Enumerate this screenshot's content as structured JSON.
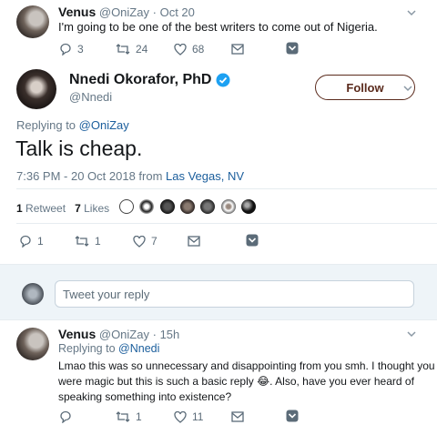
{
  "tweet1": {
    "name": "Venus",
    "handle": "@OniZay",
    "sep": "·",
    "date": "Oct 20",
    "text": "I'm going to be one of the best writers to come out of Nigeria.",
    "replies": "3",
    "retweets": "24",
    "likes": "68"
  },
  "main_tweet": {
    "name": "Nnedi Okorafor, PhD",
    "handle": "@Nnedi",
    "follow_label": "Follow",
    "replying_prefix": "Replying to",
    "replying_to": "@OniZay",
    "text": "Talk is cheap.",
    "timestamp": "7:36 PM - 20 Oct 2018 from",
    "location": "Las Vegas, NV",
    "retweets_count": "1",
    "retweets_label": "Retweet",
    "likes_count": "7",
    "likes_label": "Likes",
    "action_replies": "1",
    "action_retweets": "1",
    "action_likes": "7"
  },
  "reply_box": {
    "placeholder": "Tweet your reply"
  },
  "tweet3": {
    "name": "Venus",
    "handle": "@OniZay",
    "sep": "·",
    "date": "15h",
    "replying_prefix": "Replying to",
    "replying_to": "@Nnedi",
    "line1": "Lmao this was so unnecessary and disappointing from you smh. I thought you",
    "line2a": "were magic but this is such a basic reply",
    "emoji": "😂",
    "line2b": ". Also, have you ever heard of",
    "line3": "speaking something into existence?",
    "retweets": "1",
    "likes": "11"
  },
  "colors": {
    "link": "#1b5e9c",
    "follow_border": "#5a2a1c",
    "verified": "#1da1f2",
    "muted": "#657786"
  }
}
